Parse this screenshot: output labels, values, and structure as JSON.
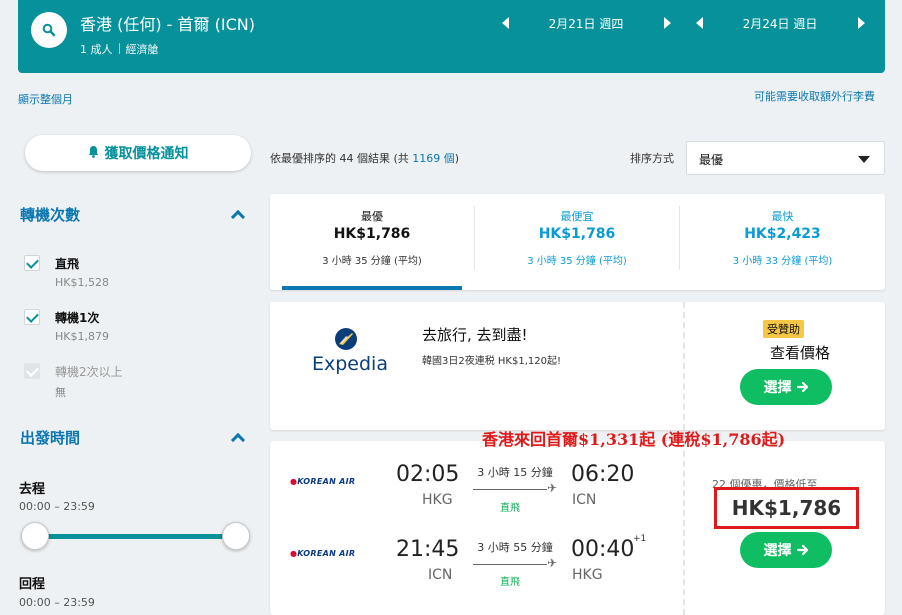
{
  "header": {
    "route": "香港 (任何) - 首爾 (ICN)",
    "passengers": "1 成人",
    "cabin": "經濟艙",
    "depart_date": "2月21日 週四",
    "return_date": "2月24日 週日"
  },
  "links": {
    "show_month": "顯示整個月",
    "extra_fees": "可能需要收取額外行李費"
  },
  "sidebar": {
    "alert_button": "獲取價格通知",
    "stops_title": "轉機次數",
    "stops": [
      {
        "label": "直飛",
        "price": "HK$1,528",
        "checked": true,
        "disabled": false
      },
      {
        "label": "轉機1次",
        "price": "HK$1,879",
        "checked": true,
        "disabled": false
      },
      {
        "label": "轉機2次以上",
        "price": "無",
        "checked": true,
        "disabled": true
      }
    ],
    "times_title": "出發時間",
    "outbound_label": "去程",
    "outbound_range": "00:00 – 23:59",
    "return_label": "回程",
    "return_range": "00:00 – 23:59"
  },
  "results": {
    "prefix": "依最優排序的 44 個結果 (共 ",
    "total": "1169 個",
    "suffix": ")",
    "sort_label": "排序方式",
    "sort_value": "最優"
  },
  "tabs": [
    {
      "title": "最優",
      "price": "HK$1,786",
      "duration": "3 小時 35 分鐘 (平均)"
    },
    {
      "title": "最便宜",
      "price": "HK$1,786",
      "duration": "3 小時 35 分鐘 (平均)"
    },
    {
      "title": "最快",
      "price": "HK$2,423",
      "duration": "3 小時 33 分鐘 (平均)"
    }
  ],
  "ad": {
    "brand": "Expedia",
    "title": "去旅行, 去到盡!",
    "subtitle": "韓國3日2夜連税 HK$1,120起!",
    "sponsored": "受贊助",
    "see_price": "查看價格",
    "select": "選擇"
  },
  "flight": {
    "airline": "KOREAN AIR",
    "outbound": {
      "depart_time": "02:05",
      "depart_airport": "HKG",
      "duration": "3 小時 15 分鐘",
      "stops": "直飛",
      "arrive_time": "06:20",
      "arrive_airport": "ICN"
    },
    "inbound": {
      "depart_time": "21:45",
      "depart_airport": "ICN",
      "duration": "3 小時 55 分鐘",
      "stops": "直飛",
      "arrive_time": "00:40",
      "arrive_plus": "+1",
      "arrive_airport": "HKG"
    },
    "deals": "22 個優惠，價格低至",
    "price": "HK$1,786",
    "select": "選擇"
  },
  "annotation": "香港來回首爾$1,331起 (連稅$1,786起)",
  "colors": {
    "brand_teal": "#06919b",
    "link_blue": "#0b77b0",
    "green": "#0fbe63",
    "red": "#e01a1a"
  }
}
